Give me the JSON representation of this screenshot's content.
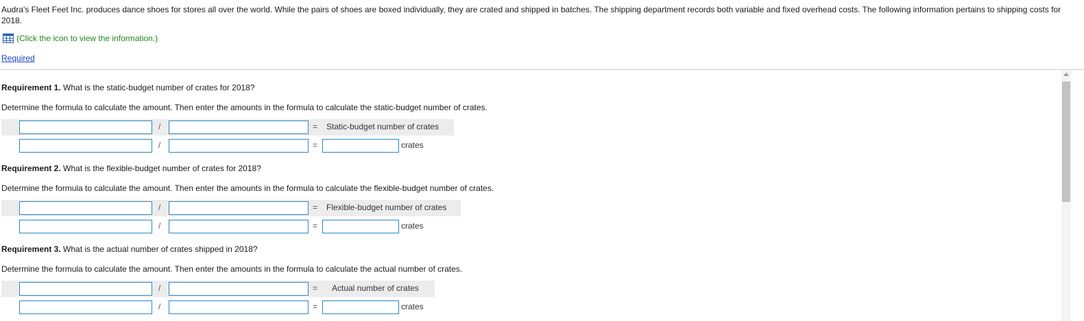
{
  "intro": {
    "text": "Audra's Fleet Feet Inc. produces dance shoes for stores all over the world. While the pairs of shoes are boxed individually, they are crated and shipped in batches. The shipping department records both variable and fixed overhead costs. The following information pertains to shipping costs for 2018."
  },
  "info_link": {
    "label": "(Click the icon to view the information.)",
    "icon": "table-icon"
  },
  "required_link": {
    "label": "Required"
  },
  "requirements": [
    {
      "heading": "Requirement 1.",
      "question": " What is the static-budget number of crates for 2018?",
      "instruction": "Determine the formula to calculate the amount. Then enter the amounts in the formula to calculate the static-budget number of crates.",
      "divide": "/",
      "equals": "=",
      "result_label": "Static-budget number of crates",
      "unit": "crates"
    },
    {
      "heading": "Requirement 2.",
      "question": " What is the flexible-budget number of crates for 2018?",
      "instruction": "Determine the formula to calculate the amount. Then enter the amounts in the formula to calculate the flexible-budget number of crates.",
      "divide": "/",
      "equals": "=",
      "result_label": "Flexible-budget number of crates",
      "unit": "crates"
    },
    {
      "heading": "Requirement 3.",
      "question": " What is the actual number of crates shipped in 2018?",
      "instruction": "Determine the formula to calculate the amount. Then enter the amounts in the formula to calculate the actual number of crates.",
      "divide": "/",
      "equals": "=",
      "result_label": "Actual number of crates",
      "unit": "crates"
    }
  ],
  "colors": {
    "input_border": "#2a87c2",
    "link": "#1a3fc4",
    "info_link": "#1c8a1c",
    "row_shade": "#ececec"
  }
}
